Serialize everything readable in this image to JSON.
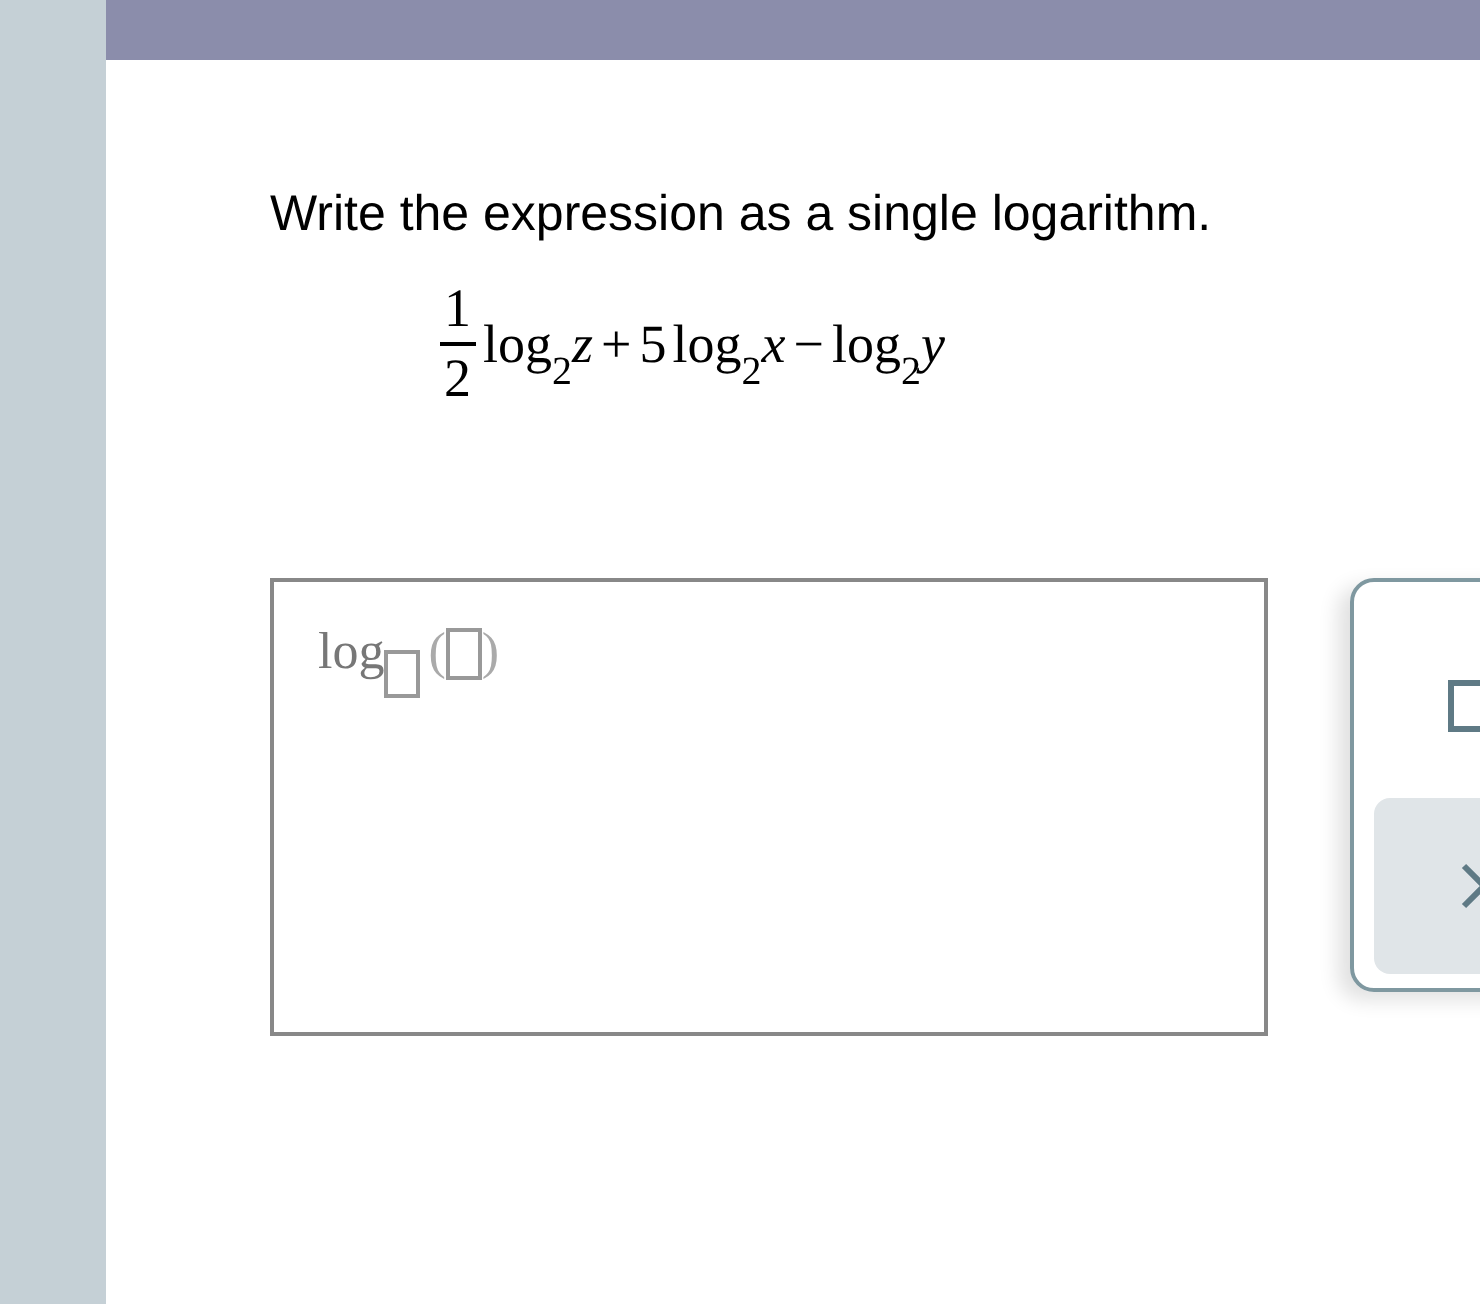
{
  "question": "Write the expression as a single logarithm.",
  "expression": [
    {
      "kind": "fraction",
      "numerator": "1",
      "denominator": "2"
    },
    {
      "kind": "log",
      "name": "log",
      "base": "2",
      "arg": "z"
    },
    {
      "kind": "op",
      "text": "+"
    },
    {
      "kind": "number",
      "text": "5"
    },
    {
      "kind": "log",
      "name": "log",
      "base": "2",
      "arg": "x"
    },
    {
      "kind": "op",
      "text": "−"
    },
    {
      "kind": "log",
      "name": "log",
      "base": "2",
      "arg": "y"
    }
  ],
  "answer": {
    "name": "log",
    "open": "(",
    "close": ")"
  },
  "tools": [
    {
      "kind": "template"
    },
    {
      "kind": "clear"
    }
  ]
}
